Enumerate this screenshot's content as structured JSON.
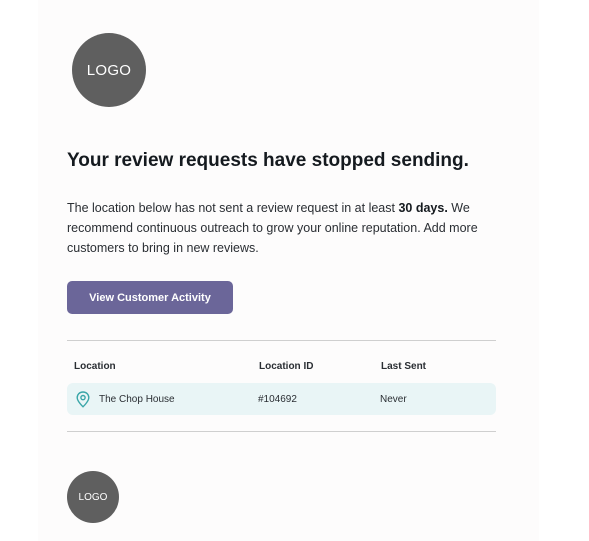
{
  "header": {
    "logo_text": "LOGO"
  },
  "message": {
    "headline": "Your review requests have stopped sending.",
    "body_before": "The location below has not sent a review request in at least ",
    "body_bold": "30 days.",
    "body_after": " We recommend continuous outreach to grow your online reputation. Add more customers to bring in new reviews."
  },
  "cta": {
    "label": "View Customer Activity"
  },
  "table": {
    "columns": [
      "Location",
      "Location ID",
      "Last Sent"
    ],
    "rows": [
      {
        "location": "The Chop House",
        "location_id": "#104692",
        "last_sent": "Never",
        "icon": "map-pin-icon"
      }
    ]
  },
  "footer": {
    "logo_text": "LOGO"
  },
  "colors": {
    "button": "#6b6699",
    "row_background": "#e9f5f6",
    "pin": "#3aa6a8",
    "logo": "#5f5f5f"
  }
}
